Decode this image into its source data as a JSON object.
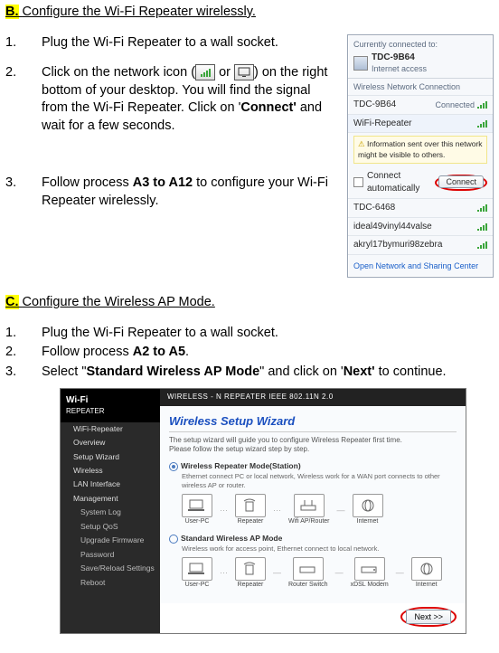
{
  "sectionB": {
    "tag": "B.",
    "title": "Configure the Wi-Fi Repeater wirelessly.",
    "step1": {
      "num": "1.",
      "text": "Plug the Wi-Fi Repeater to a wall socket."
    },
    "step2": {
      "num": "2.",
      "pre": "Click on the network icon (",
      "mid": " or ",
      "post": ") on the right bottom of your desktop. You will find the  signal from the Wi-Fi Repeater. Click on '",
      "bold": "Connect'",
      "post2": " and wait for a few seconds."
    },
    "step3": {
      "num": "3.",
      "pre": "Follow process ",
      "bold": "A3 to A12",
      "post": " to configure your Wi-Fi Repeater wirelessly."
    }
  },
  "netpanel": {
    "connected_label": "Currently connected to:",
    "primary_name": "TDC-9B64",
    "primary_status": "Internet access",
    "section_label": "Wireless Network Connection",
    "item1_name": "TDC-9B64",
    "item1_status": "Connected",
    "item2_name": "WiFi-Repeater",
    "info_text": "Information sent over this network might be visible to others.",
    "auto_label": "Connect automatically",
    "connect_btn": "Connect",
    "other1": "TDC-6468",
    "other2": "ideal49vinyl44valse",
    "other3": "akryl17bymuri98zebra",
    "footer": "Open Network and Sharing Center"
  },
  "sectionC": {
    "tag": "C.",
    "title": "Configure the Wireless AP Mode.",
    "step1": {
      "num": "1.",
      "text": "Plug the Wi-Fi Repeater to a wall socket."
    },
    "step2": {
      "num": "2.",
      "pre": "Follow process ",
      "bold": "A2 to A5",
      "post": "."
    },
    "step3": {
      "num": "3.",
      "pre": "Select \"",
      "bold1": "Standard Wireless AP Mode",
      "mid": "\" and click on '",
      "bold2": "Next'",
      "post": " to continue."
    }
  },
  "wizard": {
    "logo_line1": "Wi-Fi",
    "logo_line2": "REPEATER",
    "bar": "WIRELESS - N REPEATER    IEEE 802.11N 2.0",
    "menu": {
      "m1": "WiFi-Repeater",
      "m2": "Overview",
      "m3": "Setup Wizard",
      "m4": "Wireless",
      "m5": "LAN Interface",
      "m6": "Management",
      "s1": "System Log",
      "s2": "Setup QoS",
      "s3": "Upgrade Firmware",
      "s4": "Password",
      "s5": "Save/Reload Settings",
      "s6": "Reboot"
    },
    "title": "Wireless Setup Wizard",
    "desc1": "The setup wizard will guide you to configure Wireless Repeater first time.",
    "desc2": "Please follow the setup wizard step by step.",
    "mode1_label": "Wireless Repeater Mode(Station)",
    "mode1_sub": "Ethernet connect PC or local network, Wireless work for a WAN port connects to other wireless AP or router.",
    "mode2_label": "Standard Wireless AP Mode",
    "mode2_sub": "Wireless work for access point, Ethernet connect to local network.",
    "dev_userpc": "User-PC",
    "dev_repeater": "Repeater",
    "dev_wifiap": "Wifi AP/Router",
    "dev_router": "Router Switch",
    "dev_dsl": "xDSL Modem",
    "dev_internet": "Internet",
    "next": "Next >>"
  }
}
